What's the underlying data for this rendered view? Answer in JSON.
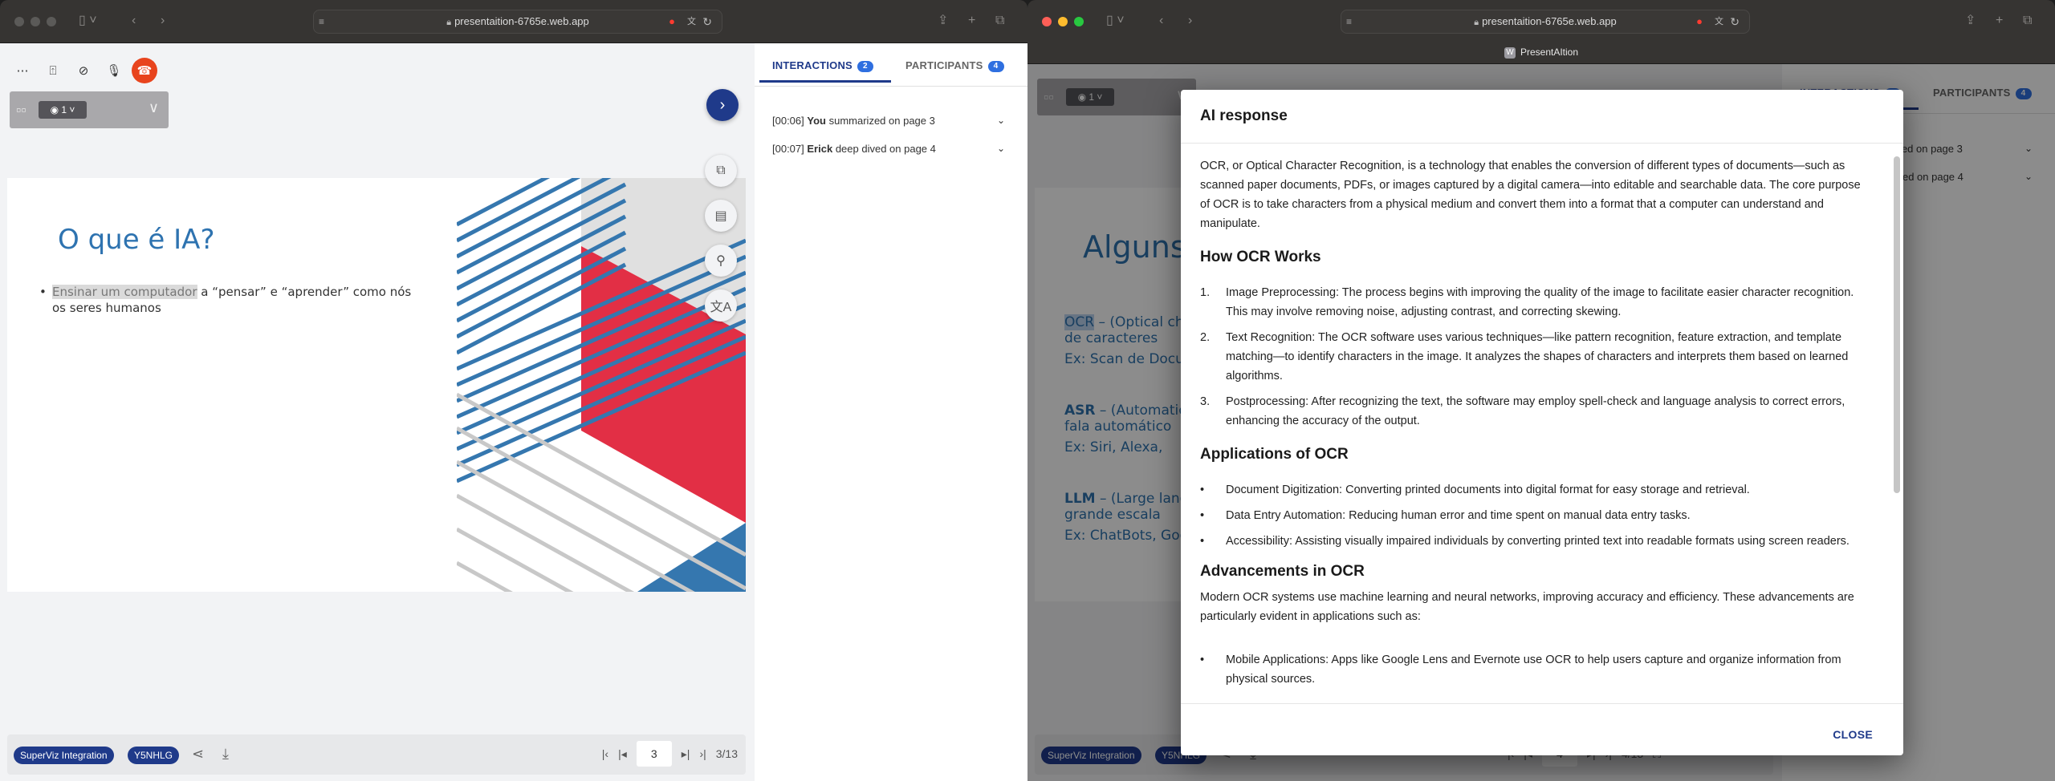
{
  "browser": {
    "url": "presentaition-6765e.web.app",
    "tab_title": "PresentAItion"
  },
  "left": {
    "viewer_count": "1",
    "slide": {
      "title": "O que é IA?",
      "bullet_highlight": "Ensinar um computador",
      "bullet_rest": " a “pensar” e “aprender” como nós os seres humanos"
    },
    "bottom": {
      "project_pill": "SuperViz Integration",
      "room_pill": "Y5NHLG",
      "current_page": "3",
      "page_count": "3/13"
    }
  },
  "panel": {
    "tabs": [
      {
        "label": "INTERACTIONS",
        "badge": "2"
      },
      {
        "label": "PARTICIPANTS",
        "badge": "4"
      }
    ],
    "interactions": [
      {
        "time": "[00:06]",
        "user": "You",
        "action": "summarized on page 3"
      },
      {
        "time": "[00:07]",
        "user": "Erick",
        "action": "deep dived on page 4"
      }
    ]
  },
  "right": {
    "viewer_count": "1",
    "slide": {
      "title": "Alguns",
      "items": [
        {
          "abbr": "OCR",
          "line1": " – (Optical ch",
          "line2": "de caracteres",
          "example": "Ex: Scan de Docu"
        },
        {
          "abbr": "ASR",
          "line1": " – (Automatic",
          "line2": "fala automático",
          "example": "Ex: Siri, Alexa,"
        },
        {
          "abbr": "LLM",
          "line1": " – (Large lang",
          "line2": "grande escala",
          "example": "Ex: ChatBots, Goo"
        }
      ]
    },
    "bottom": {
      "project_pill": "SuperViz Integration",
      "room_pill": "Y5NHLG",
      "current_page": "4",
      "page_count": "4/13"
    }
  },
  "modal": {
    "title": "AI response",
    "intro": "OCR, or Optical Character Recognition, is a technology that enables the conversion of different types of documents—such as scanned paper documents, PDFs, or images captured by a digital camera—into editable and searchable data. The core purpose of OCR is to take characters from a physical medium and convert them into a format that a computer can understand and manipulate.",
    "how_heading": "How OCR Works",
    "how_items": [
      {
        "num": "1.",
        "text": "Image Preprocessing: The process begins with improving the quality of the image to facilitate easier character recognition. This may involve removing noise, adjusting contrast, and correcting skewing."
      },
      {
        "num": "2.",
        "text": "Text Recognition: The OCR software uses various techniques—like pattern recognition, feature extraction, and template matching—to identify characters in the image. It analyzes the shapes of characters and interprets them based on learned algorithms."
      },
      {
        "num": "3.",
        "text": "Postprocessing: After recognizing the text, the software may employ spell-check and language analysis to correct errors, enhancing the accuracy of the output."
      }
    ],
    "apps_heading": "Applications of OCR",
    "apps_items": [
      "Document Digitization: Converting printed documents into digital format for easy storage and retrieval.",
      "Data Entry Automation: Reducing human error and time spent on manual data entry tasks.",
      "Accessibility: Assisting visually impaired individuals by converting printed text into readable formats using screen readers."
    ],
    "adv_heading": "Advancements in OCR",
    "adv_text": "Modern OCR systems use machine learning and neural networks, improving accuracy and efficiency. These advancements are particularly evident in applications such as:",
    "adv_items": [
      "Mobile Applications: Apps like Google Lens and Evernote use OCR to help users capture and organize information from physical sources."
    ],
    "close_label": "CLOSE"
  },
  "colors": {
    "brand_navy": "#1f3a8a",
    "end_call": "#e8441d",
    "badge_blue": "#2f6fe0",
    "slide_blue": "#2e73b0",
    "slide_red": "#e22f45"
  }
}
